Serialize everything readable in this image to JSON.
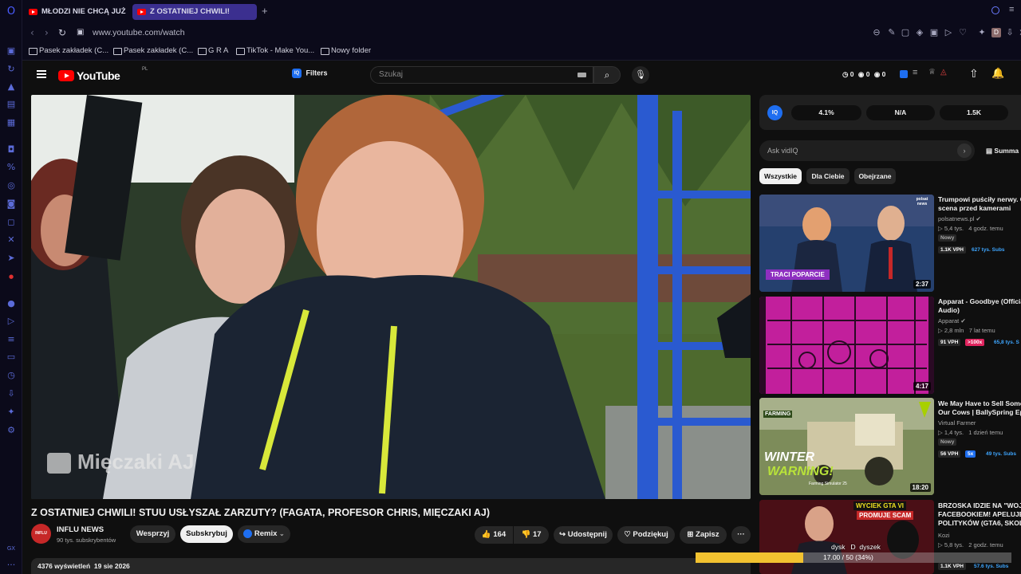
{
  "browser": {
    "tabs": [
      {
        "label": "MŁODZI NIE CHCĄ JUŻ TA"
      },
      {
        "label": "Z OSTATNIEJ CHWILI!"
      }
    ],
    "url": "www.youtube.com/watch",
    "bookmarks": [
      {
        "label": "Pasek zakładek (C..."
      },
      {
        "label": "Pasek zakładek (C..."
      },
      {
        "label": "G R A"
      },
      {
        "label": "TikTok - Make You..."
      },
      {
        "label": "Nowy folder"
      }
    ]
  },
  "header": {
    "logo": "YouTube",
    "country": "PL",
    "filters_label": "Filters",
    "search_placeholder": "Szukaj",
    "stats": [
      "0",
      "0",
      "0"
    ]
  },
  "video": {
    "watermark": "Mięczaki AJ",
    "title": "Z OSTATNIEJ CHWILI! STUU USŁYSZAŁ ZARZUTY? (FAGATA, PROFESOR CHRIS, MIĘCZAKI AJ)",
    "channel_name": "INFLU NEWS",
    "channel_avatar": "INFLU",
    "subscribers": "90 tys. subskrybentów",
    "support_label": "Wesprzyj",
    "subscribe_label": "Subskrybuj",
    "remix_label": "Remix",
    "likes": "164",
    "dislikes": "17",
    "share_label": "Udostępnij",
    "thanks_label": "Podziękuj",
    "save_label": "Zapisz",
    "views_date": "4376 wyświetleń  19 sie 2026"
  },
  "vidiq": {
    "metrics": [
      "4.1%",
      "N/A",
      "1.5K"
    ],
    "ask_placeholder": "Ask vidIQ",
    "summary_label": "Summa",
    "chips": [
      "Wszystkie",
      "Dla Ciebie",
      "Obejrzane"
    ]
  },
  "recommendations": [
    {
      "title_line1": "Trumpowi puściły nerwy. O",
      "title_line2": "scena przed kamerami",
      "channel": "polsatnews.pl",
      "meta": "5,4 tys.   4 godz. temu",
      "badge_new": "Nowy",
      "vph": "1.1K VPH",
      "subs": "627 tys. Subs",
      "duration": "2:37",
      "overlay": "TRACI POPARCIE",
      "corner_text": "polsat news"
    },
    {
      "title_line1": "Apparat - Goodbye (Official",
      "title_line2": "Audio)",
      "channel": "Apparat",
      "meta": "2,8 mln   7 lat temu",
      "vph": "91 VPH",
      "multiplier": ">100x",
      "subs": "65,8 tys. S",
      "duration": "4:17"
    },
    {
      "title_line1": "We May Have to Sell Some",
      "title_line2": "Our Cows | BallySpring Ep.8",
      "channel": "Virtual Farmer",
      "meta": "1,4 tys.   1 dzień temu",
      "badge_new": "Nowy",
      "vph": "56 VPH",
      "multiplier": "5x",
      "subs": "49 tys. Subs",
      "duration": "18:20",
      "overlay": "WINTER",
      "overlay2": "WARNING!",
      "overlay3": "Farming Simulator 25",
      "corner_text": "FARMING"
    },
    {
      "title_line1": "BRZOSKA IDZIE NA \"WOJNĘ",
      "title_line2": "FACEBOOKIEM! APELUJE D",
      "title_line3": "POLITYKÓW (GTA6, SKOLIM",
      "channel": "Kozi",
      "meta": "5,8 tys.   2 godz. temu",
      "vph": "1.1K VPH",
      "subs": "57.6 tys. Subs",
      "overlay": "WYCIEK GTA VI",
      "overlay2": "PROMUJE SCAM"
    }
  ],
  "download": {
    "label": "dysk   D  dyszek",
    "progress_text": "17.00 / 50 (34%)",
    "progress_fraction": 0.34
  },
  "colors": {
    "youtube_red": "#ff0000",
    "vidiq_blue": "#1e6ef0",
    "opera_accent": "#5b6bd8",
    "progress": "#f2c230"
  }
}
